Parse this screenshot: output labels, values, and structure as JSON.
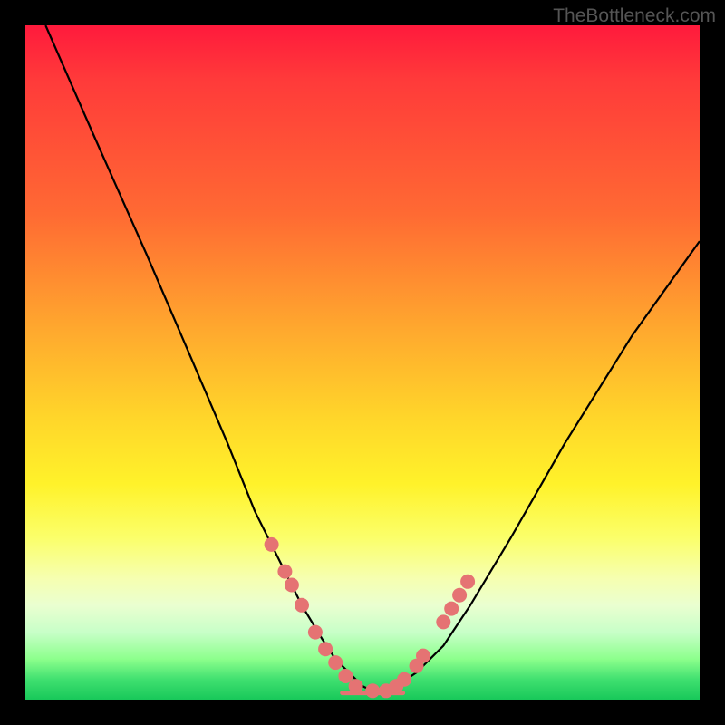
{
  "watermark": "TheBottleneck.com",
  "colors": {
    "frame": "#000000",
    "dot": "#e57373",
    "curve": "#000000",
    "gradient_stops": [
      "#ff1a3c",
      "#ff6a33",
      "#ffd52a",
      "#fbff6a",
      "#eaffd0",
      "#18c85a"
    ]
  },
  "chart_data": {
    "type": "line",
    "title": "",
    "xlabel": "",
    "ylabel": "",
    "xlim": [
      0,
      100
    ],
    "ylim": [
      0,
      100
    ],
    "grid": false,
    "legend": false,
    "series": [
      {
        "name": "left-curve",
        "x": [
          3,
          10,
          18,
          24,
          30,
          34,
          38,
          41,
          44,
          46,
          48,
          50,
          52
        ],
        "y": [
          100,
          84,
          66,
          52,
          38,
          28,
          20,
          14,
          9,
          6,
          4,
          2,
          1
        ]
      },
      {
        "name": "right-curve",
        "x": [
          52,
          55,
          58,
          62,
          66,
          72,
          80,
          90,
          100
        ],
        "y": [
          1,
          2,
          4,
          8,
          14,
          24,
          38,
          54,
          68
        ]
      },
      {
        "name": "valley-floor",
        "x": [
          47,
          56
        ],
        "y": [
          1,
          1
        ]
      }
    ],
    "scatter_points": {
      "name": "dots",
      "x": [
        36.5,
        38.5,
        39.5,
        41.0,
        43.0,
        44.5,
        46.0,
        47.5,
        49.0,
        51.5,
        53.5,
        55.0,
        56.2,
        58.0,
        59.0,
        62.0,
        63.2,
        64.4,
        65.6
      ],
      "y": [
        23.0,
        19.0,
        17.0,
        14.0,
        10.0,
        7.5,
        5.5,
        3.5,
        2.0,
        1.3,
        1.3,
        2.0,
        3.0,
        5.0,
        6.5,
        11.5,
        13.5,
        15.5,
        17.5
      ]
    }
  }
}
